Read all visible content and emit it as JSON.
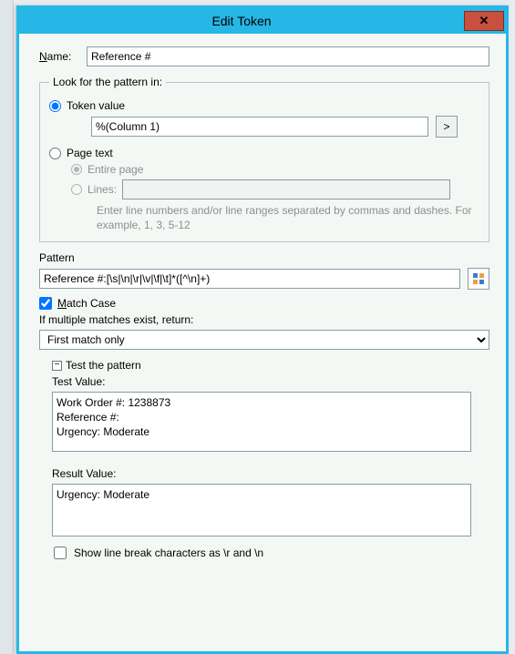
{
  "window": {
    "title": "Edit Token"
  },
  "name": {
    "label_pre": "N",
    "label_post": "ame:",
    "value": "Reference #"
  },
  "lookfor": {
    "legend": "Look for the pattern in:",
    "token_value_label": "Token value",
    "token_value_input": "%(Column 1)",
    "expand_btn": ">",
    "page_text_label": "Page text",
    "entire_page_label": "Entire page",
    "lines_label": "Lines:",
    "lines_value": "",
    "hint": "Enter line numbers and/or line ranges separated by commas and dashes.  For example, 1, 3, 5-12"
  },
  "pattern": {
    "label": "Pattern",
    "value": "Reference #:[\\s|\\n|\\r|\\v|\\f|\\t]*([^\\n]+)"
  },
  "match": {
    "case_pre": "M",
    "case_post": "atch Case",
    "multi_label": "If multiple matches exist, return:",
    "return_value": "First match only"
  },
  "test": {
    "toggle_label": "Test the pattern",
    "test_label": "Test Value:",
    "test_value": "Work Order #: 1238873\nReference #:\nUrgency: Moderate",
    "result_label": "Result Value:",
    "result_value": "Urgency: Moderate",
    "show_lb_label": "Show line break characters as \\r and \\n"
  }
}
